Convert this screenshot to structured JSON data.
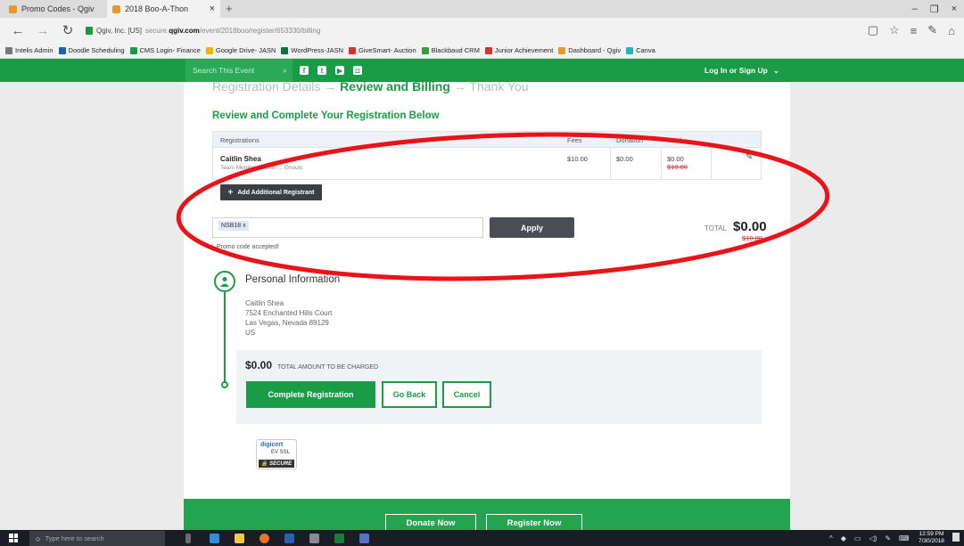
{
  "browser": {
    "tabs": [
      "Promo Codes - Qgiv",
      "2018 Boo-A-Thon"
    ],
    "tab_close": "×",
    "new_tab": "+",
    "window_controls": [
      "–",
      "❐",
      "×"
    ],
    "url_owner": "Qgiv, Inc. [US]",
    "url_prefix": "secure.",
    "url_domain": "qgiv.com",
    "url_path": "/event/2018boo/register/653330/billing",
    "bookmarks": [
      {
        "label": "Intelis Admin",
        "color": "#777777"
      },
      {
        "label": "Doodle Scheduling",
        "color": "#1a5fb4"
      },
      {
        "label": "CMS Login- Finance",
        "color": "#1a9b46"
      },
      {
        "label": "Google Drive- JASN",
        "color": "#f2b400"
      },
      {
        "label": "WordPress-JASN",
        "color": "#0f6f3c"
      },
      {
        "label": "GiveSmart- Auction",
        "color": "#d8322a"
      },
      {
        "label": "Blackbaud CRM",
        "color": "#3a9d3a"
      },
      {
        "label": "Junior Achievement",
        "color": "#d8322a"
      },
      {
        "label": "Dashboard - Qgiv",
        "color": "#e69a2b"
      },
      {
        "label": "Canva",
        "color": "#22b3c9"
      }
    ]
  },
  "site": {
    "search_placeholder": "Search This Event",
    "login": "Log In or Sign Up",
    "steps": [
      "Registration Details",
      "Review and Billing",
      "Thank You"
    ],
    "heading": "Review and Complete Your Registration Below",
    "table": {
      "headers": [
        "Registrations",
        "Fees",
        "Donation",
        "Total"
      ],
      "name": "Caitlin Shea",
      "detail": "Team Member, Caitlin ... Ghouls",
      "fee": "$10.00",
      "donation": "$0.00",
      "total": "$0.00",
      "total_original": "$10.00"
    },
    "add_registrant": "Add Additional Registrant",
    "promo_code": "NSB18 x",
    "apply": "Apply",
    "total_label": "TOTAL",
    "total_amount": "$0.00",
    "total_original": "$10.00",
    "promo_accepted": "Promo code accepted!",
    "personal_info_title": "Personal Information",
    "address": [
      "Caitlin Shea",
      "7524 Enchanted Hills Court",
      "Las Vegas, Nevada 89129",
      "US"
    ],
    "charge_amount": "$0.00",
    "charge_label": "TOTAL AMOUNT TO BE CHARGED",
    "complete": "Complete Registration",
    "go_back": "Go Back",
    "cancel": "Cancel",
    "seal": {
      "brand": "digicert",
      "type": "EV SSL",
      "status": "SECURE"
    },
    "footer_buttons": [
      "Donate Now",
      "Register Now"
    ]
  },
  "taskbar": {
    "search_placeholder": "Type here to search",
    "time": "12:59 PM",
    "date": "7/30/2018"
  }
}
